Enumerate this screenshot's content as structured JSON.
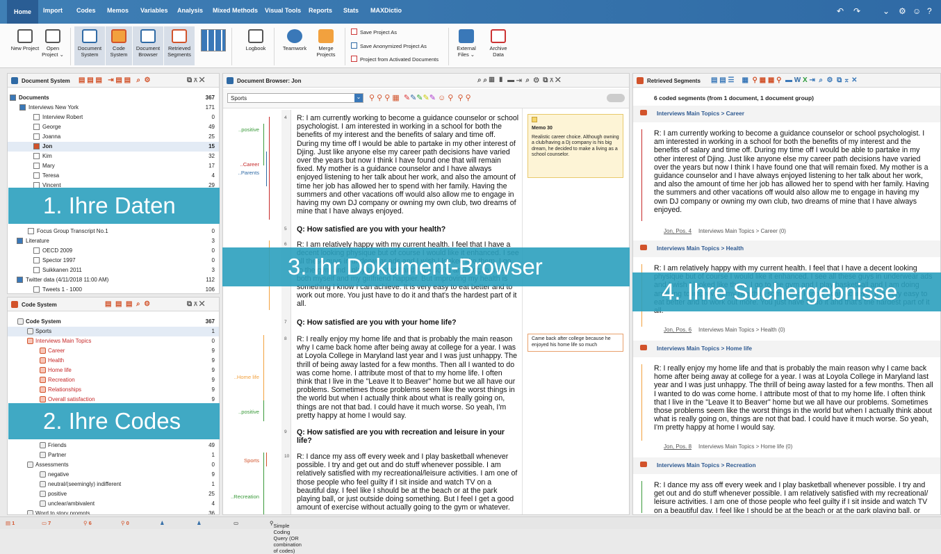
{
  "menu": {
    "items": [
      "Home",
      "Import",
      "Codes",
      "Memos",
      "Variables",
      "Analysis",
      "Mixed Methods",
      "Visual Tools",
      "Reports",
      "Stats",
      "MAXDictio"
    ]
  },
  "ribbon": {
    "new_project": "New Project",
    "open_project": "Open Project ⌄",
    "document_system": "Document System",
    "code_system": "Code System",
    "document_browser": "Document Browser",
    "retrieved_segments": "Retrieved Segments",
    "logbook": "Logbook",
    "teamwork": "Teamwork",
    "merge_projects": "Merge Projects",
    "save_project_as": "Save Project As",
    "save_anonymized": "Save Anonymized Project As",
    "project_from_activated": "Project from Activated Documents",
    "external_files": "External Files ⌄",
    "archive_data": "Archive Data"
  },
  "doc_system": {
    "title": "Document System",
    "rows": [
      {
        "label": "Documents",
        "count": "367"
      },
      {
        "label": "Interviews New York",
        "count": "171"
      },
      {
        "label": "Interview Robert",
        "count": "0"
      },
      {
        "label": "George",
        "count": "49"
      },
      {
        "label": "Joanna",
        "count": "25"
      },
      {
        "label": "Jon",
        "count": "15"
      },
      {
        "label": "Kim",
        "count": "32"
      },
      {
        "label": "Mary",
        "count": "17"
      },
      {
        "label": "Teresa",
        "count": "4"
      },
      {
        "label": "Vincent",
        "count": "29"
      },
      {
        "label": "Focus Group Transcript No.1",
        "count": "0"
      },
      {
        "label": "Literature",
        "count": "3"
      },
      {
        "label": "OECD 2009",
        "count": "0"
      },
      {
        "label": "Spector 1997",
        "count": "0"
      },
      {
        "label": "Suikkanen 2011",
        "count": "3"
      },
      {
        "label": "Twitter data (4/11/2018 11:00 AM)",
        "count": "112"
      },
      {
        "label": "Tweets 1 - 1000",
        "count": "106"
      }
    ]
  },
  "code_system": {
    "title": "Code System",
    "rows": [
      {
        "label": "Code System",
        "count": "367"
      },
      {
        "label": "Sports",
        "count": "1"
      },
      {
        "label": "Interviews Main Topics",
        "count": "0"
      },
      {
        "label": "Career",
        "count": "9"
      },
      {
        "label": "Health",
        "count": "9"
      },
      {
        "label": "Home life",
        "count": "9"
      },
      {
        "label": "Recreation",
        "count": "9"
      },
      {
        "label": "Relationships",
        "count": "9"
      },
      {
        "label": "Overall satisfaction",
        "count": "9"
      },
      {
        "label": "Friends",
        "count": "49"
      },
      {
        "label": "Partner",
        "count": "1"
      },
      {
        "label": "Assessments",
        "count": "0"
      },
      {
        "label": "negative",
        "count": "9"
      },
      {
        "label": "neutral/(seemingly) indifferent",
        "count": "1"
      },
      {
        "label": "positive",
        "count": "25"
      },
      {
        "label": "unclear/ambivalent",
        "count": "4"
      },
      {
        "label": "Word to story prompts",
        "count": "36"
      }
    ]
  },
  "doc_browser": {
    "title": "Document Browser: Jon",
    "code_select": "Sports",
    "paragraphs": [
      {
        "num": "4",
        "text": "R: I am currently working to become a guidance counselor or school psychologist. I am interested in working in a school for both the benefits of my interest and the benefits of salary and time off. During my time off I would be able to partake in my other interest of Djing. Just like anyone else my career path decisions have varied over the years but now I think I have found one that will remain fixed. My mother is a guidance counselor and I have always enjoyed listening to her talk about her work, and also the amount of time her job has allowed her to spend with her family. Having the summers and other vacations off would also allow me to engage in having my own DJ company or owning my own club, two dreams of mine that I have always enjoyed."
      },
      {
        "num": "5",
        "text": "Q: How satisfied are you with your health?"
      },
      {
        "num": "6",
        "text": "R: I am relatively happy with my current health. I feel that I have a decent looking physique but of course I would like it enhanced. I see all these guys in underwear ads and I wish I looked like them. I go to the gym and I play basketball and I am doing anything to make both myself and my girlfriend happier. But improving my health is something I know I can achieve. It is very easy to eat better and to work out more. You just have to do it and that's the hardest part of it all."
      },
      {
        "num": "7",
        "text": "Q: How satisfied are you with your home life?"
      },
      {
        "num": "8",
        "text": "R: I really enjoy my home life and that is probably the main reason why I came back home after being away at college for a year. I was at Loyola College in Maryland last year and I was just unhappy. The thrill of being away lasted for a few months. Then all I wanted to do was come home. I attribute most of that to my home life. I often think that I live in the \"Leave It to Beaver\" home but we all have our problems. Sometimes those problems seem like the worst things in the world but when I actually think about what is really going on, things are not that bad. I could have it much worse. So yeah, I'm pretty happy at home I would say."
      },
      {
        "num": "9",
        "text": "Q: How satisfied are you with recreation and leisure in your life?"
      },
      {
        "num": "10",
        "text": "R: I dance my ass off every week and I play basketball whenever possible. I try and get out and do stuff whenever possible. I am relatively satisfied with my recreational/leisure activities. I am one of those people who feel guilty if I sit inside and watch TV on a beautiful day. I feel like I should be at the beach or at the park playing ball, or just outside doing something. But I feel I get a good amount of exercise without actually going to the gym or whatever."
      }
    ],
    "side_labels": [
      "..positive",
      "..Career",
      "..Parents",
      "..Home life",
      "..positive",
      "Sports",
      "..Recreation"
    ],
    "memo1_title": "Memo 30",
    "memo1_text": "Realistic career choice. Although owning a club/having a Dj company is his big dream, he decided to make a living as a school counselor.",
    "memo2_text": "Came back after college because he enjoyed his home life so much"
  },
  "retrieved": {
    "title": "Retrieved Segments",
    "summary": "6 coded segments (from 1 document, 1 document group)",
    "segments": [
      {
        "code": "Interviews Main Topics > Career",
        "text": "R: I am currently working to become a guidance counselor or school psychologist. I am interested in working in a school for both the benefits of my interest and the benefits of salary and time off. During my time off I would be able to partake in my other interest of Djing. Just like anyone else my career path decisions have varied over the years but now I think I have found one that will remain fixed. My mother is a guidance counselor and I have always enjoyed listening to her talk about her work, and also the amount of time her job has allowed her to spend with her family. Having the summers and other vacations off would also allow me to engage in having my own DJ company or owning my own club, two dreams of mine that I have always enjoyed.",
        "src": "Jon, Pos. 4",
        "ref": "Interviews Main Topics > Career (0)"
      },
      {
        "code": "Interviews Main Topics > Health",
        "text": "R: I am relatively happy with my current health. I feel that I have a decent looking physique but of course I would like it enhanced. I see all these guys in underwear ads and I wish I looked like them. I go to the gym and I play basketball and I am doing anything to improving my health is something I know I can achieve. It is very easy to eat better and to work out more. You just have to do it and that's the hardest part of it all.",
        "src": "Jon, Pos. 6",
        "ref": "Interviews Main Topics > Health (0)"
      },
      {
        "code": "Interviews Main Topics > Home life",
        "text": "R: I really enjoy my home life and that is probably the main reason why I came back home after being away at college for a year. I was at Loyola College in Maryland last year and I was just unhappy. The thrill of being away lasted for a few months. Then all I wanted to do was come home. I attribute most of that to my home life. I often think that I live in the \"Leave It to Beaver\" home but we all have our problems. Sometimes those problems seem like the worst things in the world but when I actually think about what is really going on, things are not that bad. I could have it much worse. So yeah, I'm pretty happy at home I would say.",
        "src": "Jon, Pos. 8",
        "ref": "Interviews Main Topics > Home life (0)"
      },
      {
        "code": "Interviews Main Topics > Recreation",
        "text": "R: I dance my ass off every week and I play basketball whenever possible. I try and get out and do stuff whenever possible. I am relatively satisfied with my recreational/ leisure activities. I am one of those people who feel guilty if I sit inside and watch TV on a beautiful day. I feel like I should be at the beach or at the park playing ball, or",
        "src": "",
        "ref": ""
      }
    ]
  },
  "overlays": {
    "daten": "1. Ihre Daten",
    "codes": "2. Ihre Codes",
    "browser": "3. Ihr Dokument-Browser",
    "suche": "4. Ihre Suchergebnisse"
  },
  "status": {
    "docs": "1",
    "codes": "7",
    "c3": "6",
    "c4": "0",
    "query": "Simple Coding Query (OR combination of codes)"
  }
}
